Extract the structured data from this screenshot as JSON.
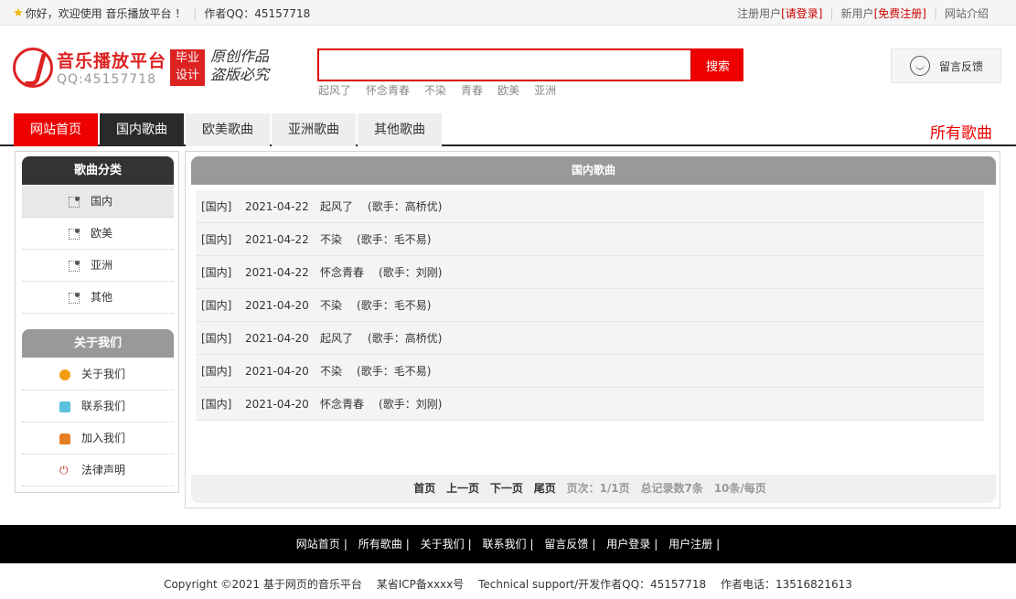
{
  "topbar": {
    "welcome": "你好，欢迎使用 音乐播放平台 ！",
    "author_qq": "作者QQ：45157718",
    "register_label": "注册用户",
    "login_link": "[请登录]",
    "new_user_label": "新用户",
    "signup_link": "[免费注册]",
    "about_site": "网站介绍"
  },
  "logo": {
    "title": "音乐播放平台",
    "qq": "QQ:45157718",
    "badge_line1": "毕业",
    "badge_line2": "设计",
    "script_line1": "原创作品",
    "script_line2": "盗版必究"
  },
  "search": {
    "placeholder": "",
    "button_label": "搜索",
    "hotwords": [
      "起风了",
      "怀念青春",
      "不染",
      "青春",
      "欧美",
      "亚洲"
    ]
  },
  "feedback": {
    "label": "留言反馈"
  },
  "nav": {
    "items": [
      "网站首页",
      "国内歌曲",
      "欧美歌曲",
      "亚洲歌曲",
      "其他歌曲"
    ],
    "all_songs": "所有歌曲"
  },
  "sidebar": {
    "category_title": "歌曲分类",
    "categories": [
      "国内",
      "欧美",
      "亚洲",
      "其他"
    ],
    "about_title": "关于我们",
    "about_items": [
      "关于我们",
      "联系我们",
      "加入我们",
      "法律声明"
    ]
  },
  "content": {
    "title": "国内歌曲",
    "songs": [
      {
        "cat": "[国内]",
        "date": "2021-04-22",
        "name": "起风了",
        "singer": "(歌手：高桥优)"
      },
      {
        "cat": "[国内]",
        "date": "2021-04-22",
        "name": "不染",
        "singer": "(歌手：毛不易)"
      },
      {
        "cat": "[国内]",
        "date": "2021-04-22",
        "name": "怀念青春",
        "singer": "(歌手：刘刚)"
      },
      {
        "cat": "[国内]",
        "date": "2021-04-20",
        "name": "不染",
        "singer": "(歌手：毛不易)"
      },
      {
        "cat": "[国内]",
        "date": "2021-04-20",
        "name": "起风了",
        "singer": "(歌手：高桥优)"
      },
      {
        "cat": "[国内]",
        "date": "2021-04-20",
        "name": "不染",
        "singer": "(歌手：毛不易)"
      },
      {
        "cat": "[国内]",
        "date": "2021-04-20",
        "name": "怀念青春",
        "singer": "(歌手：刘刚)"
      }
    ],
    "pager": {
      "first": "首页",
      "prev": "上一页",
      "next": "下一页",
      "last": "尾页",
      "page_info": "页次：1/1页",
      "total_info": "总记录数7条",
      "per_page": "10条/每页"
    }
  },
  "footer": {
    "links": [
      "网站首页",
      "所有歌曲",
      "关于我们",
      "联系我们",
      "留言反馈",
      "用户登录",
      "用户注册"
    ],
    "separator": "|",
    "copyright": "Copyright ©2021 基于网页的音乐平台",
    "icp": "某省ICP备xxxx号",
    "support": "Technical support/开发作者QQ：45157718",
    "phone": "作者电话：13516821613"
  },
  "colors": {
    "brand_red": "#ee0000",
    "dark": "#2a2a2a",
    "gray_head": "#999999"
  }
}
